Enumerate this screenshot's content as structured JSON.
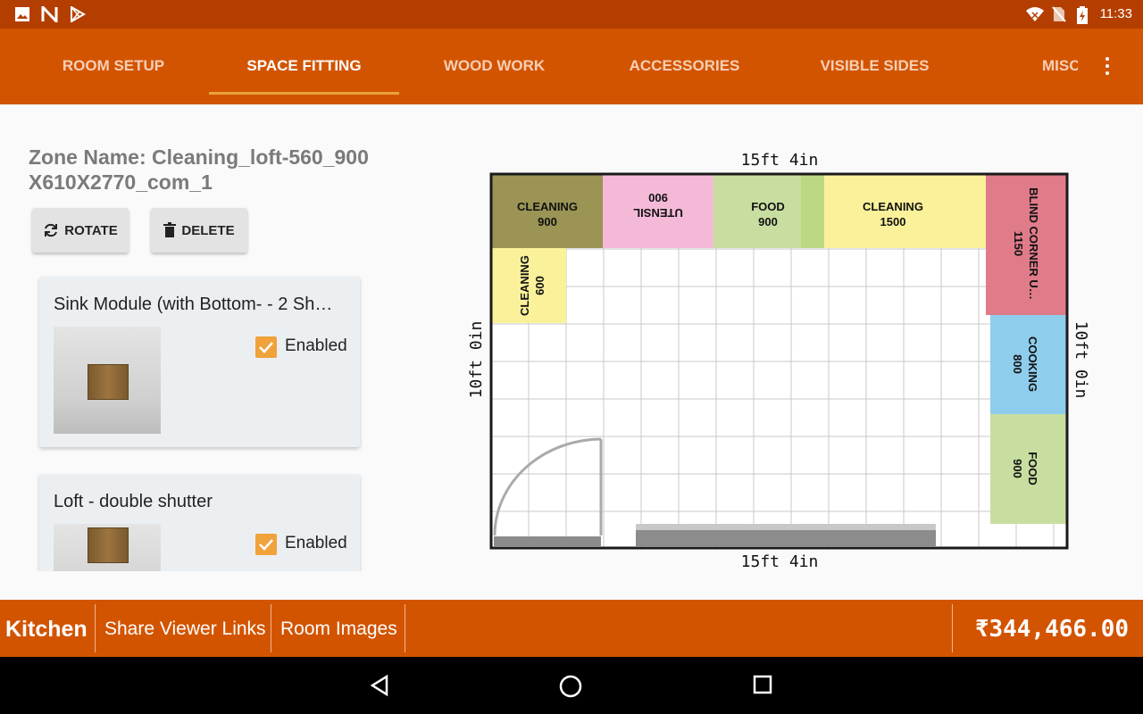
{
  "status_bar": {
    "time": "11:33",
    "left_icons": [
      "gallery-icon",
      "n-notification-icon",
      "play-store-icon"
    ],
    "right_icons": [
      "wifi-icon",
      "no-sim-icon",
      "battery-charging-icon"
    ]
  },
  "tabs": [
    {
      "label": "ROOM SETUP",
      "active": false
    },
    {
      "label": "SPACE FITTING",
      "active": true
    },
    {
      "label": "WOOD WORK",
      "active": false
    },
    {
      "label": "ACCESSORIES",
      "active": false
    },
    {
      "label": "VISIBLE SIDES",
      "active": false
    },
    {
      "label": "MISC",
      "active": false
    }
  ],
  "zone": {
    "name_line1": "Zone Name: Cleaning_loft-560_900",
    "name_line2": "X610X2770_com_1"
  },
  "actions": {
    "rotate_label": "ROTATE",
    "delete_label": "DELETE"
  },
  "modules": [
    {
      "title": "Sink Module (with Bottom- - 2 Sh…",
      "enabled_label": "Enabled",
      "enabled": true
    },
    {
      "title": "Loft - double shutter",
      "enabled_label": "Enabled",
      "enabled": true
    }
  ],
  "plan": {
    "top_dimension": "15ft 4in",
    "bottom_dimension": "15ft 4in",
    "left_dimension": "10ft 0in",
    "right_dimension": "10ft 0in",
    "blocks": [
      {
        "name": "CLEANING",
        "value": "900",
        "color": "#9b9455"
      },
      {
        "name": "UTENSIL",
        "value": "900",
        "color": "#f5b9d8"
      },
      {
        "name": "FOOD",
        "value": "900",
        "color": "#c8dea0"
      },
      {
        "name": "CLEANING",
        "value": "1500",
        "color": "#faf19a"
      },
      {
        "name": "BLIND CORNER U…",
        "value": "1150",
        "color": "#e07c8a"
      },
      {
        "name": "CLEANING",
        "value": "600",
        "color": "#faf19a"
      },
      {
        "name": "COOKING",
        "value": "800",
        "color": "#8fcdec"
      },
      {
        "name": "FOOD",
        "value": "900",
        "color": "#c8dea0"
      }
    ]
  },
  "bottom_bar": {
    "room": "Kitchen",
    "share_label": "Share Viewer Links",
    "images_label": "Room Images",
    "price": "₹344,466.00"
  },
  "colors": {
    "status_bar": "#b43e00",
    "primary": "#d35400",
    "tab_indicator": "#e9a23b",
    "checkbox": "#f0a23b"
  }
}
